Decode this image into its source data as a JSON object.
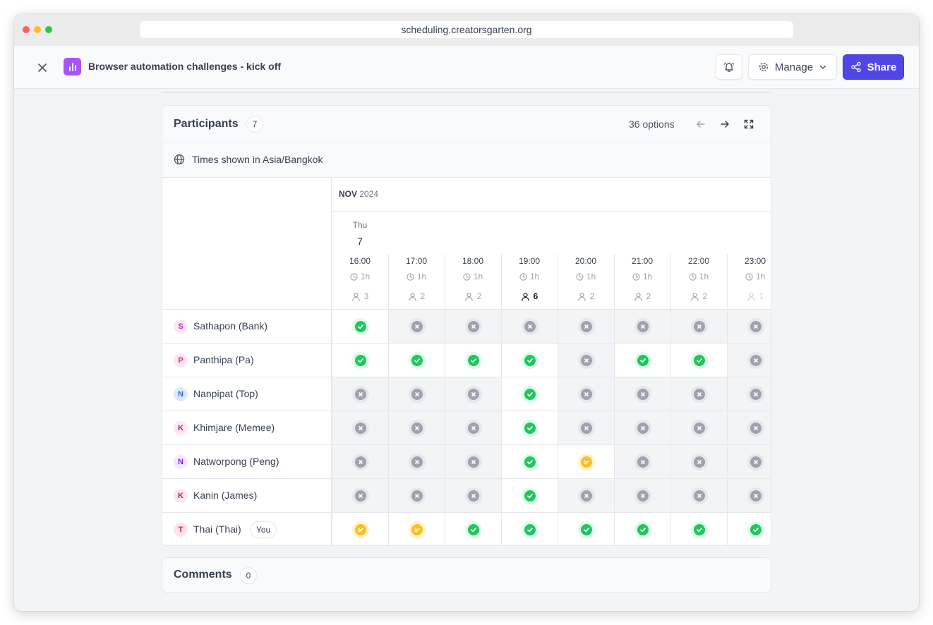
{
  "browser": {
    "url": "scheduling.creatorsgarten.org"
  },
  "header": {
    "title": "Browser automation challenges - kick off",
    "manage_label": "Manage",
    "share_label": "Share"
  },
  "participants": {
    "title": "Participants",
    "count": "7",
    "options_label": "36 options",
    "timezone_label": "Times shown in Asia/Bangkok",
    "month": "NOV",
    "year": "2024",
    "day_of_week": "Thu",
    "day_of_month": "7",
    "time_slots": [
      {
        "time": "16:00",
        "duration": "1h",
        "attendees": "3"
      },
      {
        "time": "17:00",
        "duration": "1h",
        "attendees": "2"
      },
      {
        "time": "18:00",
        "duration": "1h",
        "attendees": "2"
      },
      {
        "time": "19:00",
        "duration": "1h",
        "attendees": "6",
        "best": true
      },
      {
        "time": "20:00",
        "duration": "1h",
        "attendees": "2"
      },
      {
        "time": "21:00",
        "duration": "1h",
        "attendees": "2"
      },
      {
        "time": "22:00",
        "duration": "1h",
        "attendees": "2"
      },
      {
        "time": "23:00",
        "duration": "1h",
        "attendees": "1"
      }
    ],
    "people": [
      {
        "initial": "S",
        "name": "Sathapon (Bank)",
        "avatar_bg": "#fce7f3",
        "avatar_fg": "#c026d3",
        "votes": [
          "yes",
          "no",
          "no",
          "no",
          "no",
          "no",
          "no",
          "no"
        ]
      },
      {
        "initial": "P",
        "name": "Panthipa (Pa)",
        "avatar_bg": "#fce7f3",
        "avatar_fg": "#db2777",
        "votes": [
          "yes",
          "yes",
          "yes",
          "yes",
          "no",
          "yes",
          "yes",
          "no"
        ]
      },
      {
        "initial": "N",
        "name": "Nanpipat (Top)",
        "avatar_bg": "#dbeafe",
        "avatar_fg": "#2563eb",
        "votes": [
          "no",
          "no",
          "no",
          "yes",
          "no",
          "no",
          "no",
          "no"
        ]
      },
      {
        "initial": "K",
        "name": "Khimjare (Memee)",
        "avatar_bg": "#fce7f3",
        "avatar_fg": "#be185d",
        "votes": [
          "no",
          "no",
          "no",
          "yes",
          "no",
          "no",
          "no",
          "no"
        ]
      },
      {
        "initial": "N",
        "name": "Natworpong (Peng)",
        "avatar_bg": "#f3e8ff",
        "avatar_fg": "#7e22ce",
        "votes": [
          "no",
          "no",
          "no",
          "yes",
          "maybe",
          "no",
          "no",
          "no"
        ]
      },
      {
        "initial": "K",
        "name": "Kanin (James)",
        "avatar_bg": "#fce7f3",
        "avatar_fg": "#be185d",
        "votes": [
          "no",
          "no",
          "no",
          "yes",
          "no",
          "no",
          "no",
          "no"
        ]
      },
      {
        "initial": "T",
        "name": "Thai (Thai)",
        "avatar_bg": "#ffe4e6",
        "avatar_fg": "#e11d48",
        "you": "You",
        "votes": [
          "maybe",
          "maybe",
          "yes",
          "yes",
          "yes",
          "yes",
          "yes",
          "yes"
        ]
      }
    ]
  },
  "comments": {
    "title": "Comments",
    "count": "0"
  },
  "colors": {
    "accent": "#4f46e5",
    "yes": "#22c55e",
    "no": "#9ca3af",
    "maybe": "#fbbf24",
    "poll_icon": "#a855f7"
  }
}
